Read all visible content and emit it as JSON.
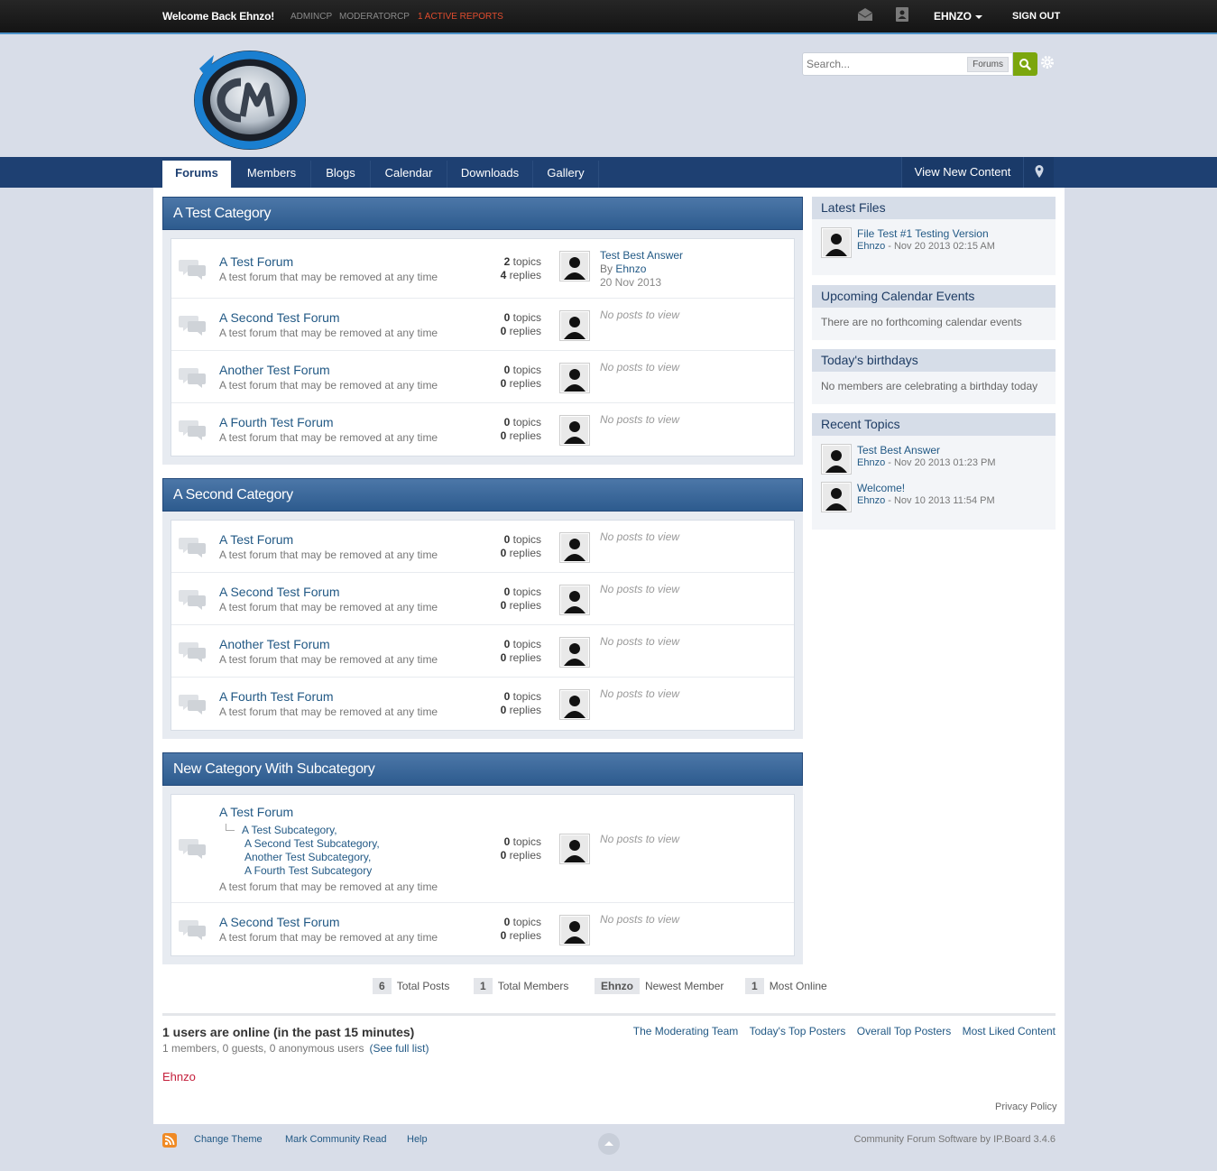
{
  "userbar": {
    "welcome": "Welcome Back Ehnzo!",
    "admincp": "ADMINCP",
    "modcp": "MODERATORCP",
    "reports": "1 ACTIVE REPORTS",
    "username": "EHNZO",
    "signout": "SIGN OUT"
  },
  "search": {
    "placeholder": "Search...",
    "scope": "Forums"
  },
  "nav": {
    "tabs": [
      "Forums",
      "Members",
      "Blogs",
      "Calendar",
      "Downloads",
      "Gallery"
    ],
    "view_new": "View New Content"
  },
  "categories": [
    {
      "title": "A Test Category",
      "forums": [
        {
          "title": "A Test Forum",
          "desc": "A test forum that may be removed at any time",
          "topics": "2",
          "replies": "4",
          "last_title": "Test Best Answer",
          "last_by": "By",
          "last_user": "Ehnzo",
          "last_date": "20 Nov 2013"
        },
        {
          "title": "A Second Test Forum",
          "desc": "A test forum that may be removed at any time",
          "topics": "0",
          "replies": "0",
          "none": "No posts to view"
        },
        {
          "title": "Another Test Forum",
          "desc": "A test forum that may be removed at any time",
          "topics": "0",
          "replies": "0",
          "none": "No posts to view"
        },
        {
          "title": "A Fourth Test Forum",
          "desc": "A test forum that may be removed at any time",
          "topics": "0",
          "replies": "0",
          "none": "No posts to view"
        }
      ]
    },
    {
      "title": "A Second Category",
      "forums": [
        {
          "title": "A Test Forum",
          "desc": "A test forum that may be removed at any time",
          "topics": "0",
          "replies": "0",
          "none": "No posts to view"
        },
        {
          "title": "A Second Test Forum",
          "desc": "A test forum that may be removed at any time",
          "topics": "0",
          "replies": "0",
          "none": "No posts to view"
        },
        {
          "title": "Another Test Forum",
          "desc": "A test forum that may be removed at any time",
          "topics": "0",
          "replies": "0",
          "none": "No posts to view"
        },
        {
          "title": "A Fourth Test Forum",
          "desc": "A test forum that may be removed at any time",
          "topics": "0",
          "replies": "0",
          "none": "No posts to view"
        }
      ]
    },
    {
      "title": "New Category With Subcategory",
      "forums": [
        {
          "title": "A Test Forum",
          "subs": [
            "A Test Subcategory,",
            "A Second Test Subcategory,",
            "Another Test Subcategory,",
            "A Fourth Test Subcategory"
          ],
          "desc": "A test forum that may be removed at any time",
          "topics": "0",
          "replies": "0",
          "none": "No posts to view"
        },
        {
          "title": "A Second Test Forum",
          "desc": "A test forum that may be removed at any time",
          "topics": "0",
          "replies": "0",
          "none": "No posts to view"
        }
      ]
    }
  ],
  "labels": {
    "topics": "topics",
    "replies": "replies"
  },
  "sidebar": {
    "latest_files": {
      "title": "Latest Files",
      "items": [
        {
          "title": "File Test #1 Testing Version",
          "user": "Ehnzo",
          "meta": " - Nov 20 2013 02:15 AM"
        }
      ]
    },
    "calendar": {
      "title": "Upcoming Calendar Events",
      "text": "There are no forthcoming calendar events"
    },
    "birthdays": {
      "title": "Today's birthdays",
      "text": "No members are celebrating a birthday today"
    },
    "recent": {
      "title": "Recent Topics",
      "items": [
        {
          "title": "Test Best Answer",
          "user": "Ehnzo",
          "meta": " - Nov 20 2013 01:23 PM"
        },
        {
          "title": "Welcome!",
          "user": "Ehnzo",
          "meta": " - Nov 10 2013 11:54 PM"
        }
      ]
    }
  },
  "stats": {
    "total_posts": "6",
    "total_posts_label": "Total Posts",
    "total_members": "1",
    "total_members_label": "Total Members",
    "newest": "Ehnzo",
    "newest_label": "Newest Member",
    "most_online": "1",
    "most_online_label": "Most Online"
  },
  "online": {
    "title": "1 users are online (in the past 15 minutes)",
    "sub": "1 members, 0 guests, 0 anonymous users",
    "full_list": "(See full list)",
    "links": [
      "The Moderating Team",
      "Today's Top Posters",
      "Overall Top Posters",
      "Most Liked Content"
    ],
    "user": "Ehnzo"
  },
  "privacy": "Privacy Policy",
  "footer": {
    "change_theme": "Change Theme",
    "mark_read": "Mark Community Read",
    "help": "Help",
    "copyright": "Community Forum Software by IP.Board 3.4.6"
  },
  "colors": {
    "nav": "#1e4072",
    "accent": "#4b91c8",
    "search_button": "#7ba60d",
    "report": "#e04c2e",
    "online_user": "#c41e3a"
  }
}
